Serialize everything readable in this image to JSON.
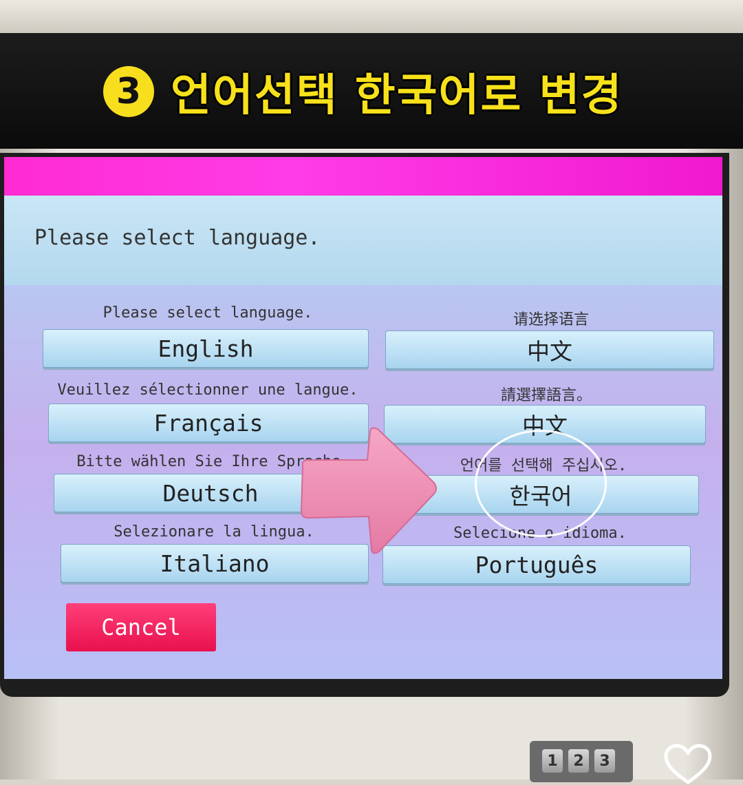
{
  "caption": {
    "step_number": "3",
    "text": "언어선택 한국어로 변경",
    "badge_color": "#f7df1e",
    "text_color": "#f7e11a"
  },
  "screen": {
    "title": "Please select language."
  },
  "languages": [
    {
      "prompt": "Please select language.",
      "label": "English"
    },
    {
      "prompt": "请选择语言",
      "label": "中文"
    },
    {
      "prompt": "Veuillez sélectionner une langue.",
      "label": "Français"
    },
    {
      "prompt": "請選擇語言。",
      "label": "中文"
    },
    {
      "prompt": "Bitte wählen Sie Ihre Sprache.",
      "label": "Deutsch"
    },
    {
      "prompt": "언어를 선택해 주십시오.",
      "label": "한국어"
    },
    {
      "prompt": "Selezionare la lingua.",
      "label": "Italiano"
    },
    {
      "prompt": "Selecione o idioma.",
      "label": "Português"
    }
  ],
  "cancel_label": "Cancel",
  "keypad": [
    "1",
    "2",
    "3"
  ],
  "icons": {
    "arrow": "pointing-arrow-icon",
    "highlight": "highlight-circle",
    "like": "heart-icon"
  },
  "colors": {
    "magenta_bar": "#ff2bd3",
    "cancel": "#e8104d",
    "arrow": "#f08ab0"
  }
}
